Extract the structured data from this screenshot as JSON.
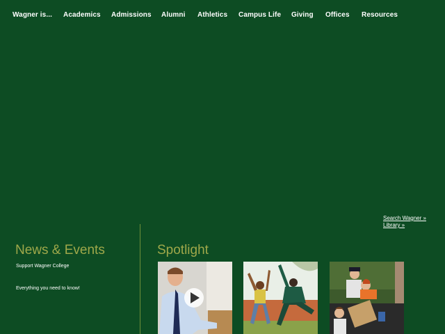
{
  "nav": {
    "items": [
      {
        "label": "Wagner is..."
      },
      {
        "label": "Academics"
      },
      {
        "label": "Admissions"
      },
      {
        "label": "Alumni"
      },
      {
        "label": "Athletics"
      },
      {
        "label": "Campus Life"
      },
      {
        "label": "Giving"
      },
      {
        "label": "Offices"
      },
      {
        "label": "Resources"
      }
    ]
  },
  "search": {
    "label": "Search Wagner »",
    "label2": "Library »"
  },
  "news": {
    "heading": "News & Events",
    "links": [
      "Support Wagner College",
      "Everything you need to know!"
    ]
  },
  "spotlight": {
    "heading": "Spotlight"
  },
  "colors": {
    "background": "#0d4c23",
    "heading": "#9fa84a",
    "divider": "#6f8f3a"
  }
}
